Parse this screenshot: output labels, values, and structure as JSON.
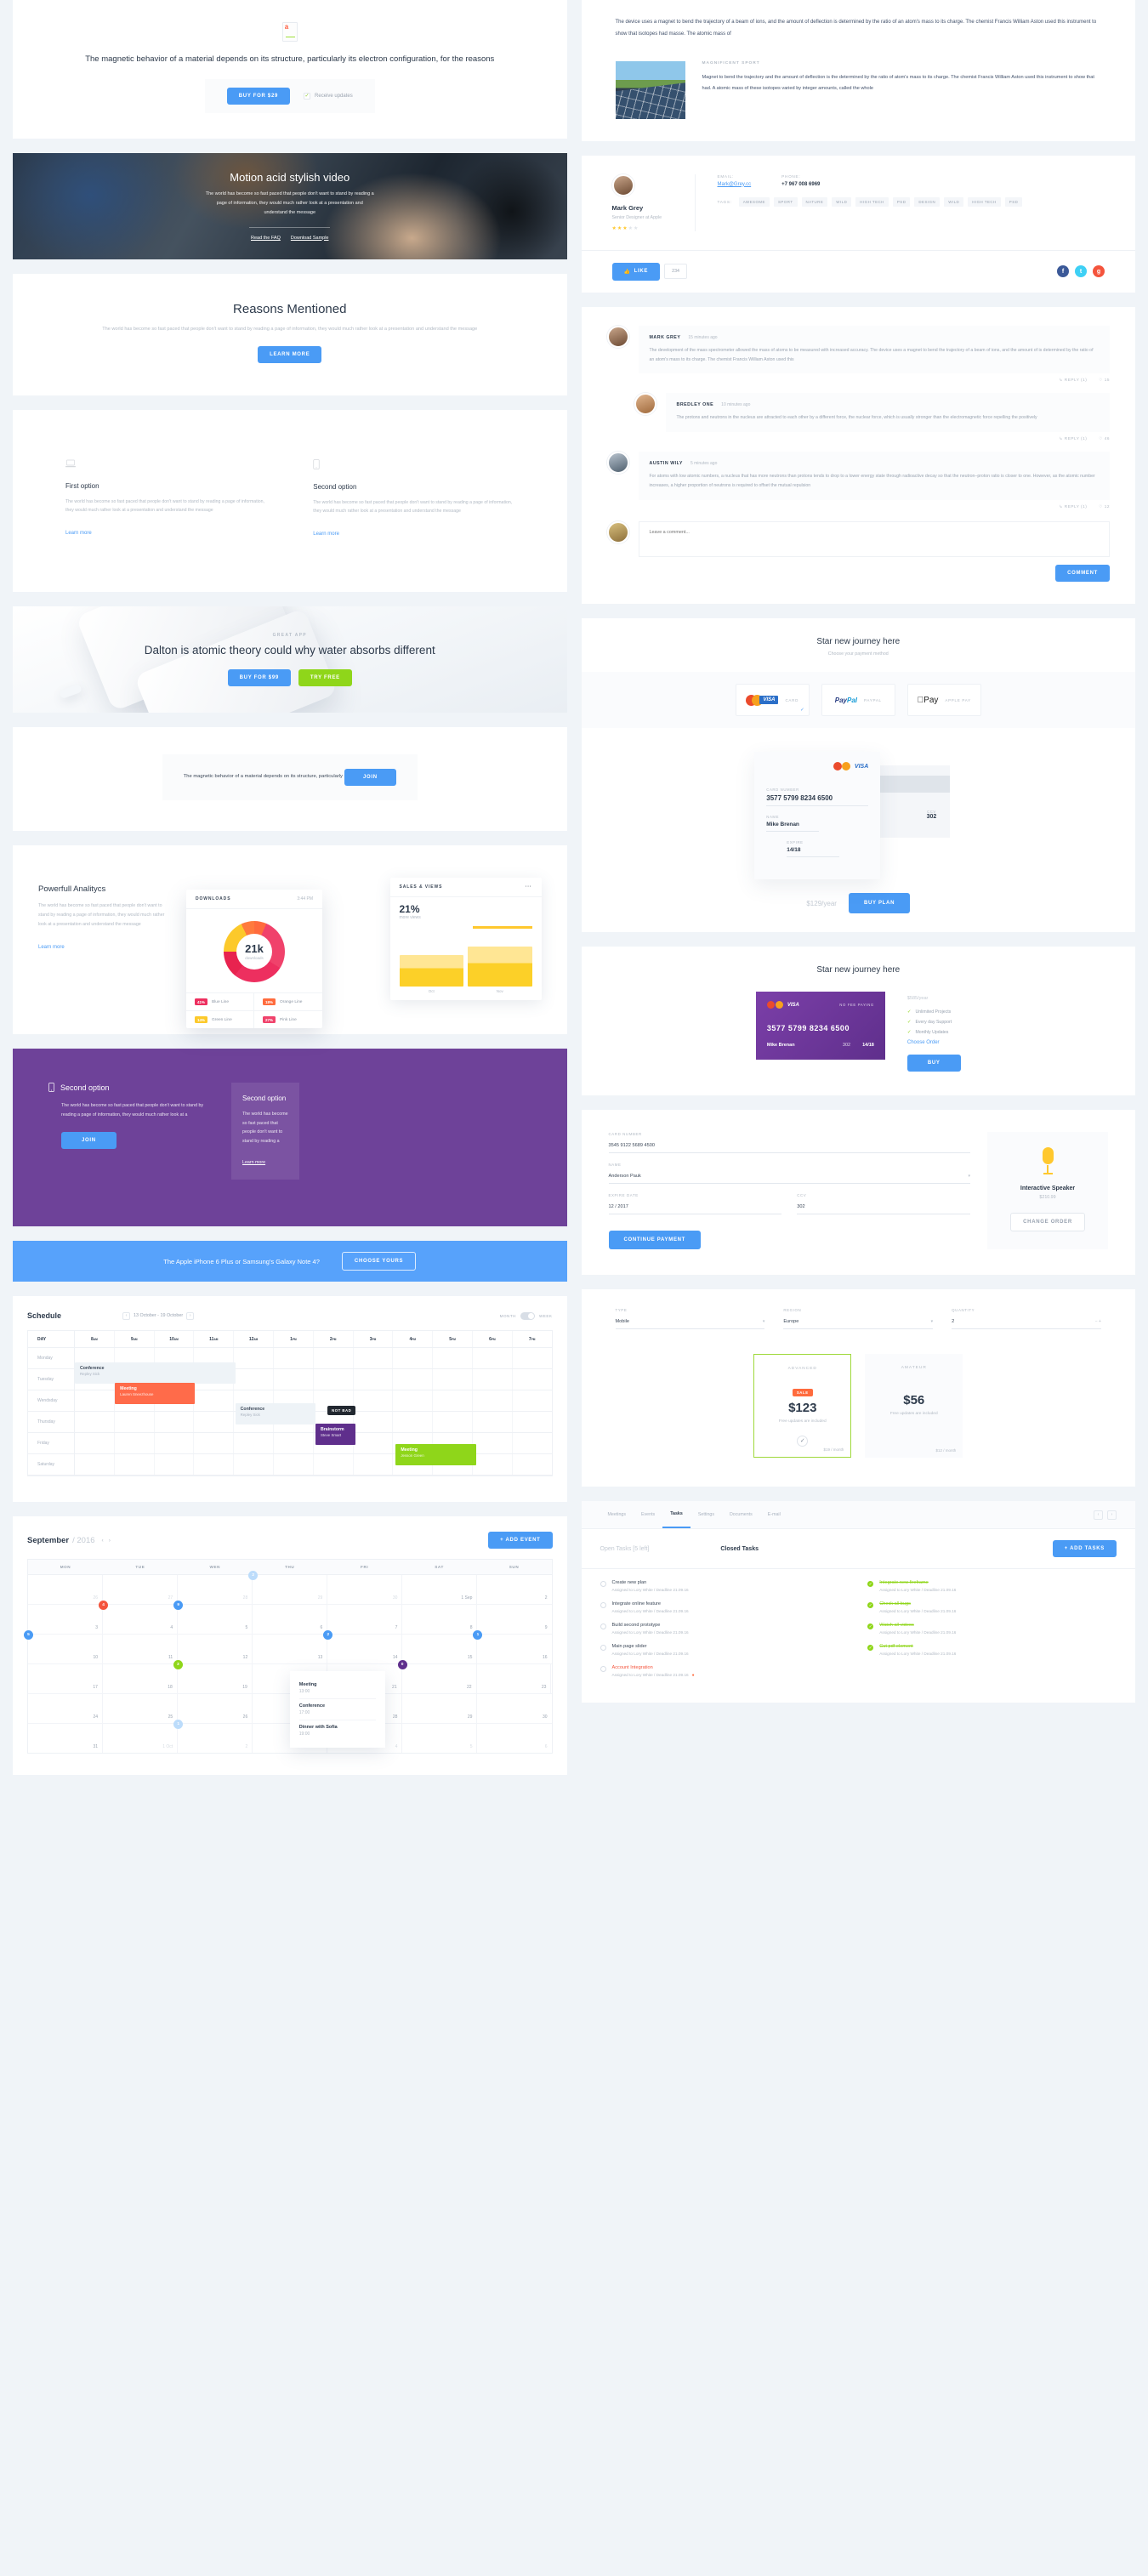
{
  "promo": {
    "icon": "document-icon",
    "headline": "The magnetic behavior of a material depends on its structure, particularly its electron configuration, for the reasons",
    "buy_label": "BUY FOR $29",
    "checkbox_label": "Receive updates"
  },
  "video_hero": {
    "title": "Motion acid stylish video",
    "body": "The world has become so fast paced that people don't want to stand by reading a page of information, they would much rather look at a presentation and understand the message",
    "link_faq": "Read the FAQ",
    "link_sample": "Download Sample"
  },
  "reasons": {
    "title": "Reasons Mentioned",
    "body": "The world has become so fast paced that people don't want to stand by reading a page of information, they would much rather look at a presentation and understand the message",
    "button": "LEARN MORE"
  },
  "options": [
    {
      "icon": "laptop-icon",
      "title": "First option",
      "body": "The world has become so fast paced that people don't want to stand by reading a page of information, they would much rather look at a presentation and understand the message",
      "link": "Learn more"
    },
    {
      "icon": "mobile-icon",
      "title": "Second option",
      "body": "The world has become so fast paced that people don't want to stand by reading a page of information, they would much rather look at a presentation and understand the message",
      "link": "Learn more"
    }
  ],
  "phone_hero": {
    "eyebrow": "GREAT APP",
    "title": "Dalton is atomic theory could why water absorbs different",
    "buy_label": "BUY FOR $99",
    "try_label": "TRY FREE"
  },
  "join_strip": {
    "text": "The magnetic behavior of a material depends on its structure, particularly",
    "button": "JOIN"
  },
  "analytics": {
    "title": "Powerfull Analitycs",
    "body": "The world has become so fast paced that people don't want to stand by reading a page of information, they would much rather look at a presentation and understand the message",
    "link": "Learn more",
    "back_widget": {
      "title": "SALES & VIEWS",
      "menu": "···",
      "percent": "21%",
      "sub": "more views",
      "months": [
        "Oct",
        "Nov"
      ]
    },
    "front_widget": {
      "title": "DOWNLOADS",
      "time": "3:44 PM",
      "center_value": "21k",
      "center_label": "downloads"
    }
  },
  "chart_data": {
    "type": "pie",
    "title": "DOWNLOADS",
    "center_value": "21k",
    "center_label": "downloads",
    "categories": [
      "Blue Line",
      "Orange Line",
      "Green Line",
      "Pink Line"
    ],
    "values": [
      41,
      18,
      14,
      27
    ],
    "value_labels": [
      "41%",
      "18%",
      "14%",
      "27%"
    ],
    "colors": [
      "#ed2f5f",
      "#ff6b3d",
      "#fcc92b",
      "#f0426b"
    ],
    "legend": "bottom-grid",
    "secondary": {
      "type": "bar",
      "title": "SALES & VIEWS",
      "categories": [
        "Oct",
        "Nov"
      ],
      "values": [
        62,
        78
      ],
      "headline": "21%",
      "headline_sub": "more views"
    }
  },
  "purple": {
    "icon": "mobile-icon",
    "left_title": "Second option",
    "left_body": "The world has become so fast paced that people don't want to stand by reading a page of information, they would much rather look at a",
    "left_button": "JOIN",
    "right_title": "Second option",
    "right_body": "The world has become so fast paced that people don't want to stand by reading a",
    "right_link": "Learn more"
  },
  "blue_cta": {
    "text": "The Apple iPhone 6 Plus or Samsung's Galaxy Note 4?",
    "button": "CHOOSE YOURS"
  },
  "schedule": {
    "title": "Schedule",
    "range": "13 October - 19 October",
    "prev": "‹",
    "next": "›",
    "toggle_left": "MONTH",
    "toggle_right": "WEEK",
    "day_header": "DAY",
    "hours": [
      "8",
      "9",
      "10",
      "11",
      "12",
      "1",
      "2",
      "3",
      "4",
      "5",
      "6",
      "7"
    ],
    "hour_suffix": [
      "AM",
      "AM",
      "AM",
      "AM",
      "AM",
      "PM",
      "PM",
      "PM",
      "PM",
      "PM",
      "PM",
      "PM"
    ],
    "days": [
      "Monday",
      "Tuesday",
      "Wendsday",
      "Thursday",
      "Friday",
      "Saturday"
    ],
    "events": [
      {
        "title": "Conference",
        "person": "Repley Sick",
        "style": "ghost",
        "row": 1,
        "start": 0,
        "span": 4
      },
      {
        "title": "Meeting",
        "person": "Lauren Sneezhouse",
        "color": "#ff6b4a",
        "row": 2,
        "start": 1,
        "span": 2
      },
      {
        "title": "Conference",
        "person": "Repley Sick",
        "style": "ghost",
        "row": 3,
        "start": 4,
        "span": 2
      },
      {
        "title": "Brainstorm",
        "person": "Steve Smart",
        "color": "#5f2f8c",
        "row": 4,
        "start": 6,
        "span": 1
      },
      {
        "title": "Meeting",
        "person": "Jesson Green",
        "color": "#8fd61a",
        "row": 5,
        "start": 8,
        "span": 2
      }
    ],
    "tooltip": "NOT BAD"
  },
  "month_calendar": {
    "month": "September",
    "year": "/ 2016",
    "prev": "‹",
    "next": "›",
    "add_button": "+ ADD EVENT",
    "weekdays": [
      "MON",
      "TUE",
      "WEN",
      "THU",
      "FRI",
      "SAT",
      "SUN"
    ],
    "weeks": [
      [
        {
          "num": "26",
          "out": true
        },
        {
          "num": "27",
          "out": true
        },
        {
          "num": "28",
          "out": true
        },
        {
          "num": "29",
          "out": true,
          "badge": "2",
          "badge_color": "#bcdcfb"
        },
        {
          "num": "30",
          "out": true
        },
        {
          "num": "1 Sep"
        },
        {
          "num": "2"
        }
      ],
      [
        {
          "num": "3"
        },
        {
          "num": "4",
          "badge": "4",
          "badge_color": "#f4543c"
        },
        {
          "num": "5",
          "badge": "9",
          "badge_color": "#4a9bf5"
        },
        {
          "num": "6"
        },
        {
          "num": "7"
        },
        {
          "num": "8"
        },
        {
          "num": "9"
        }
      ],
      [
        {
          "num": "10",
          "badge": "5",
          "badge_color": "#4a9bf5"
        },
        {
          "num": "11"
        },
        {
          "num": "12"
        },
        {
          "num": "13"
        },
        {
          "num": "14",
          "badge": "2",
          "badge_color": "#4a9bf5"
        },
        {
          "num": "15"
        },
        {
          "num": "16",
          "badge": "1",
          "badge_color": "#4a9bf5"
        }
      ],
      [
        {
          "num": "17"
        },
        {
          "num": "18"
        },
        {
          "num": "19",
          "badge": "3",
          "badge_color": "#8fd61a"
        },
        {
          "num": "20"
        },
        {
          "num": "21"
        },
        {
          "num": "22",
          "badge": "0",
          "badge_color": "#5f2f8c"
        },
        {
          "num": "23"
        }
      ],
      [
        {
          "num": "24"
        },
        {
          "num": "25"
        },
        {
          "num": "26"
        },
        {
          "num": "27"
        },
        {
          "num": "28"
        },
        {
          "num": "29"
        },
        {
          "num": "30"
        }
      ],
      [
        {
          "num": "31"
        },
        {
          "num": "1 Oct",
          "out": true
        },
        {
          "num": "2",
          "out": true,
          "badge": "1",
          "badge_color": "#bcdcfb"
        },
        {
          "num": "3",
          "out": true
        },
        {
          "num": "4",
          "out": true
        },
        {
          "num": "5",
          "out": true
        },
        {
          "num": "6",
          "out": true
        }
      ]
    ],
    "popover": [
      {
        "title": "Meeting",
        "time": "13:00"
      },
      {
        "title": "Conference",
        "time": "17:00"
      },
      {
        "title": "Dinner with Sofia",
        "time": "19:00"
      }
    ]
  },
  "article": {
    "lead": "The device uses a magnet to bend the trajectory of a beam of ions, and the amount of deflection is determined by the ratio of an atom's mass to its charge. The chemist Francis William Aston used this instrument to show that isotopes had masse. The atomic mass of",
    "photo": "solar-panel-photo",
    "eyebrow": "MAGNIFICENT SPORT",
    "body": "Magnet to bend the trajectory and the amount of deflection is the determined by the ratio of atom's mass to its charge. The chemist Francis William Aston used this instrument to show that had. A atomic mass of these isotopes varied by integer amounts, called the whole"
  },
  "profile": {
    "name": "Mark Grey",
    "role": "Senior Designer at Apple",
    "rating": 3,
    "email_label": "EMAIL:",
    "email": "Mark@Grey.cc",
    "phone_label": "PHONE:",
    "phone": "+7 967 008 6969",
    "tags_label": "TAGS:",
    "tags": [
      "AWESOME",
      "SPORT",
      "NATURE",
      "WILD",
      "HIGH TECH",
      "PSD",
      "DESIGN",
      "WILD",
      "HIGH TECH",
      "PSD"
    ],
    "like_label": "LIKE",
    "like_count": "234",
    "socials": [
      "facebook-icon",
      "twitter-icon",
      "google-plus-icon"
    ]
  },
  "comments": {
    "items": [
      {
        "name": "MARK GREY",
        "time": "15 minutes ago",
        "body": "The development of the mass spectrometer allowed the mass of atoms to be measured with increased accuracy. The device uses a magnet to bend the trajectory of a beam of ions, and the amount of  is determined by the ratio of an atom's mass to its charge. The chemist Francis William Aston used this",
        "reply": "REPLY (1)",
        "likes": "15",
        "indent": false
      },
      {
        "name": "BREDLEY ONE",
        "time": "10 minutes ago",
        "body": "The protons and neutrons in the nucleus are attracted to each other by a different force, the nuclear force, which is usually stronger than the electromagnetic force repelling the positively",
        "reply": "REPLY (1)",
        "likes": "46",
        "indent": true
      },
      {
        "name": "AUSTIN WILY",
        "time": "5 minutes ago",
        "body": "For atoms with low atomic numbers, a nucleus that has more neutrons than protons tends to drop to a lower energy state through radioactive decay so that the neutron–proton ratio is closer to one. However, as the atomic number increases, a higher proportion of neutrons is required to offset the mutual repulsion",
        "reply": "REPLY (1)",
        "likes": "12",
        "indent": false
      }
    ],
    "placeholder": "Leave a comment...",
    "submit": "COMMENT"
  },
  "payment": {
    "title": "Star new journey here",
    "subtitle": "Choose your payment method",
    "methods": [
      {
        "name": "CARD",
        "icon": "visa-mastercard-icon",
        "selected": true
      },
      {
        "name": "PAYPAL",
        "icon": "paypal-icon",
        "selected": false
      },
      {
        "name": "APPLE PAY",
        "icon": "apple-pay-icon",
        "selected": false
      }
    ],
    "card_number_label": "CARD NUMBER",
    "card_number": "3577 5799 8234 6500",
    "name_label": "NAME",
    "name": "Mike Brenan",
    "expire_label": "EXPIRE",
    "expire": "14/18",
    "ccv_label": "CCV",
    "ccv": "302",
    "price": "$129",
    "period": "/year",
    "buy_button": "BUY PLAN"
  },
  "checkout": {
    "title": "Star new journey here",
    "card": {
      "brand": "VISA",
      "pay_note": "NO FEE PAYING",
      "number": "3577 5799 8234 6500",
      "name": "Mike Brenan",
      "ccv": "302",
      "expire": "14/18"
    },
    "amount": "$585",
    "period": "/year",
    "features": [
      "Unlimited Projects",
      "Every day Support",
      "Monthly Updates"
    ],
    "change_link": "Choose Order",
    "buy_button": "BUY"
  },
  "order": {
    "card_number_label": "CARD NUMBER",
    "card_number": "3545 9122 5689 4500",
    "name_label": "NAME",
    "name": "Anderson Pauk",
    "expire_label": "EXPIRE DATE",
    "expire": "12 / 2017",
    "ccv_label": "CCV",
    "ccv": "302",
    "submit": "CONTINUE PAYMENT",
    "product_icon": "microphone-icon",
    "product_name": "Interactive Speaker",
    "product_price": "$210.99",
    "change_button": "Change Order"
  },
  "pricing": {
    "type_label": "TYPE",
    "type_value": "Mobile",
    "region_label": "REGION",
    "region_value": "Europe",
    "quantity_label": "QUANTITY",
    "quantity_value": "2",
    "plans": [
      {
        "tier": "ADVANCED",
        "sale_badge": "SALE",
        "amount": "$123",
        "note": "Free updates are included",
        "monthly": "$19 / month",
        "selected": true
      },
      {
        "tier": "AMATEUR",
        "sale_badge": "",
        "amount": "$56",
        "note": "Free updates are included",
        "monthly": "$12 / month",
        "selected": false
      }
    ]
  },
  "tasks": {
    "tabs": [
      "Meetings",
      "Events",
      "Tasks",
      "Settings",
      "Documents",
      "E-mail"
    ],
    "active_tab": "Tasks",
    "prev": "‹",
    "next": "›",
    "open_title": "Open Tasks",
    "open_count": "[5 left]",
    "closed_title": "Closed Tasks",
    "add_button": "+ ADD TASKS",
    "open": [
      {
        "title": "Create new plan",
        "meta": "Assigned to Lory White  /  Deadline 21.09.16"
      },
      {
        "title": "Integrate online feature",
        "meta": "Assigned to Lory White  /  Deadline 21.09.16"
      },
      {
        "title": "Build second prototype",
        "meta": "Assigned to Lory White  /  Deadline 21.09.16"
      },
      {
        "title": "Main page slider",
        "meta": "Assigned to Lory White  /  Deadline 21.09.16"
      },
      {
        "title": "Account Integration",
        "meta": "Assigned to Lory White  /  Deadline 21.09.16",
        "overdue": true
      }
    ],
    "closed": [
      {
        "title": "Integrate new fireframe",
        "meta": "Assigned to Lory White  /  Deadline 21.09.16"
      },
      {
        "title": "Check all bugs",
        "meta": "Assigned to Lory White  /  Deadline 21.09.16"
      },
      {
        "title": "Watch all videos",
        "meta": "Assigned to Lory White  /  Deadline 21.09.16"
      },
      {
        "title": "Cut pdf element",
        "meta": "Assigned to Lory White  /  Deadline 21.09.16"
      }
    ]
  }
}
